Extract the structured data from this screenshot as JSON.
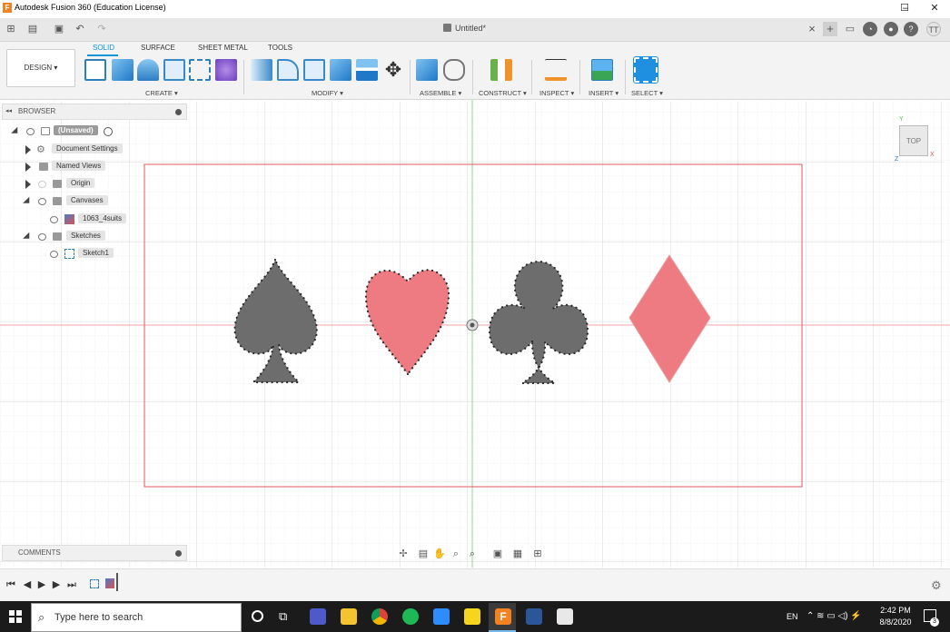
{
  "window": {
    "title": "Autodesk Fusion 360 (Education License)",
    "app_logo": "F",
    "controls": [
      "–",
      "☐",
      "✕"
    ]
  },
  "quickbar": {
    "doc_title": "Untitled*",
    "close_tab": "×",
    "new_tab": "+",
    "user_initials": "TT"
  },
  "ribbon": {
    "tabs": [
      "SOLID",
      "SURFACE",
      "SHEET METAL",
      "TOOLS"
    ],
    "active_tab": "SOLID",
    "workspace": "DESIGN ▾",
    "groups": [
      "CREATE ▾",
      "MODIFY ▾",
      "ASSEMBLE ▾",
      "CONSTRUCT ▾",
      "INSPECT ▾",
      "INSERT ▾",
      "SELECT ▾"
    ],
    "accent": "#0696d7"
  },
  "browser": {
    "title": "BROWSER",
    "collapse": "◂◂",
    "items": {
      "root": "(Unsaved)",
      "document_settings": "Document Settings",
      "named_views": "Named Views",
      "origin": "Origin",
      "canvases": "Canvases",
      "canvas_image": "1063_4suits",
      "sketches": "Sketches",
      "sketch1": "Sketch1"
    }
  },
  "comments": {
    "title": "COMMENTS"
  },
  "viewcube": {
    "face": "TOP",
    "axis_x": "X",
    "axis_y": "Y",
    "axis_z": "Z"
  },
  "canvas": {
    "suits": [
      "spade",
      "heart",
      "club",
      "diamond"
    ],
    "black_suit_color": "#6d6d6d",
    "red_suit_color": "#ef7b82",
    "frame_color": "#e05a62",
    "axis_red": "#f0a4a4",
    "axis_green": "#8fd68f"
  },
  "taskbar": {
    "search_placeholder": "Type here to search",
    "lang": "EN",
    "time": "2:42 PM",
    "date": "8/8/2020",
    "notifications": "3"
  }
}
